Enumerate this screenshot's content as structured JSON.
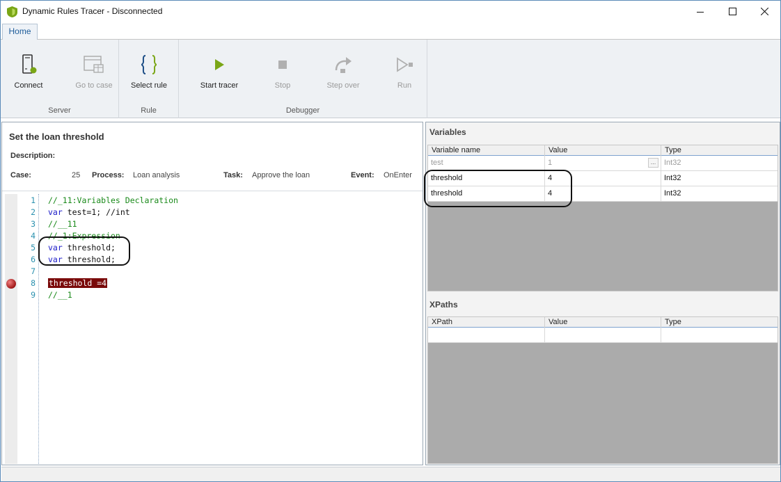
{
  "window": {
    "title": "Dynamic Rules Tracer - Disconnected",
    "min_icon": "minimize-icon",
    "max_icon": "maximize-icon",
    "close_icon": "close-icon"
  },
  "ribbon": {
    "tabs": [
      {
        "label": "Home",
        "active": true
      }
    ],
    "groups": {
      "server": {
        "label": "Server",
        "buttons": [
          {
            "label": "Connect",
            "icon": "connect-icon",
            "enabled": true
          },
          {
            "label": "Go to case",
            "icon": "go-to-case-icon",
            "enabled": false
          }
        ]
      },
      "rule": {
        "label": "Rule",
        "buttons": [
          {
            "label": "Select rule",
            "icon": "braces-icon",
            "enabled": true
          }
        ]
      },
      "debugger": {
        "label": "Debugger",
        "buttons": [
          {
            "label": "Start tracer",
            "icon": "play-icon",
            "enabled": true
          },
          {
            "label": "Stop",
            "icon": "stop-icon",
            "enabled": false
          },
          {
            "label": "Step over",
            "icon": "step-over-icon",
            "enabled": false
          },
          {
            "label": "Run",
            "icon": "run-icon",
            "enabled": false
          }
        ]
      }
    }
  },
  "rule": {
    "title": "Set the loan threshold",
    "description_label": "Description:",
    "case_label": "Case:",
    "case_value": "25",
    "process_label": "Process:",
    "process_value": "Loan analysis",
    "task_label": "Task:",
    "task_value": "Approve the loan",
    "event_label": "Event:",
    "event_value": "OnEnter"
  },
  "code": {
    "lines": [
      {
        "num": "1",
        "text": "//_11:Variables Declaration"
      },
      {
        "num": "2",
        "kw": "var",
        "text": " test=1; //int"
      },
      {
        "num": "3",
        "text": "//__11"
      },
      {
        "num": "4",
        "text": "//_1:Expression"
      },
      {
        "num": "5",
        "kw": "var",
        "text": " threshold;"
      },
      {
        "num": "6",
        "kw": "var",
        "text": " threshold;"
      },
      {
        "num": "7",
        "text": ""
      },
      {
        "num": "8",
        "text": "threshold =4",
        "breakpoint": true
      },
      {
        "num": "9",
        "text": "//__1"
      }
    ]
  },
  "variables": {
    "title": "Variables",
    "columns": [
      "Variable name",
      "Value",
      "Type"
    ],
    "rows": [
      {
        "name": "test",
        "value": "1",
        "type": "Int32",
        "muted": true,
        "ellipsis": "..."
      },
      {
        "name": "threshold",
        "value": "4",
        "type": "Int32"
      },
      {
        "name": "threshold",
        "value": "4",
        "type": "Int32"
      }
    ]
  },
  "xpaths": {
    "title": "XPaths",
    "columns": [
      "XPath",
      "Value",
      "Type"
    ]
  },
  "colors": {
    "accent": "#1d5c9a",
    "play_green": "#7aa616",
    "breakpoint_red": "#7a0a0a",
    "grid_empty": "#ababab"
  }
}
